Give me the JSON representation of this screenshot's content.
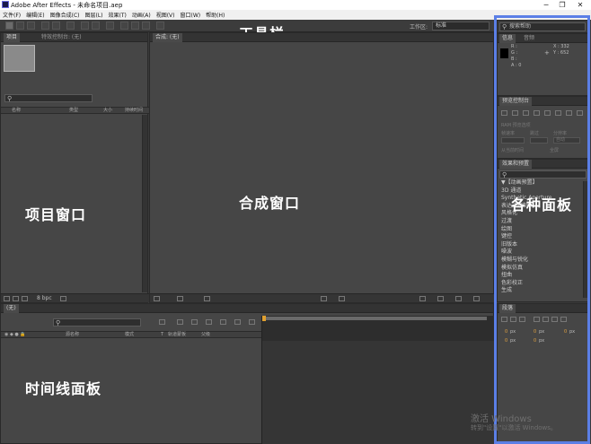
{
  "window": {
    "title": "Adobe After Effects - 未命名项目.aep",
    "minimize": "─",
    "maximize": "❐",
    "close": "✕"
  },
  "menu": [
    "文件(F)",
    "编辑(E)",
    "图像合成(C)",
    "图层(L)",
    "效果(T)",
    "动画(A)",
    "视图(V)",
    "窗口(W)",
    "帮助(H)"
  ],
  "toolbar": {
    "workspace_label": "工作区:",
    "workspace_value": "标准"
  },
  "annotations": {
    "toolbar": "工具栏",
    "project": "项目窗口",
    "composition": "合成窗口",
    "panels": "各种面板",
    "timeline": "时间线面板"
  },
  "project_panel": {
    "tabs": [
      "项目",
      "特效控制台: (无)"
    ],
    "columns": [
      "名称",
      "类型",
      "大小",
      "持续时间"
    ],
    "bpc": "8 bpc"
  },
  "composition_panel": {
    "tab": "合成: (无)"
  },
  "search_help": {
    "placeholder": "搜索帮助"
  },
  "info_panel": {
    "tabs": [
      "信息",
      "音频"
    ],
    "r": "R :",
    "g": "G :",
    "b": "B :",
    "a": "A : 0",
    "x": "X : 332",
    "y": "Y : 652"
  },
  "preview_panel": {
    "tab": "预览控制台",
    "ram": "RAM 预览选项",
    "frame_rate": "帧速率",
    "skip": "跳过",
    "resolution": "分辨率",
    "auto": "自动",
    "from_current": "从当前时间",
    "fullscreen": "全屏"
  },
  "effects_panel": {
    "tab": "效果和预置",
    "items": [
      "▼【动画预置】",
      "3D 通道",
      "Synthetic Aperture",
      "表达式控制",
      "风格化",
      "过渡",
      "绘图",
      "键控",
      "旧版本",
      "噪波",
      "模糊与锐化",
      "模拟仿真",
      "扭曲",
      "色彩校正",
      "生成"
    ]
  },
  "paragraph_panel": {
    "tab": "段落",
    "px": "px",
    "zero": "0"
  },
  "timeline_panel": {
    "tab": "(无)",
    "columns": [
      "源名称",
      "模式",
      "T",
      "轨道蒙板",
      "父级"
    ]
  },
  "watermark": {
    "line1": "激活 Windows",
    "line2": "转到\"设置\"以激活 Windows。"
  }
}
